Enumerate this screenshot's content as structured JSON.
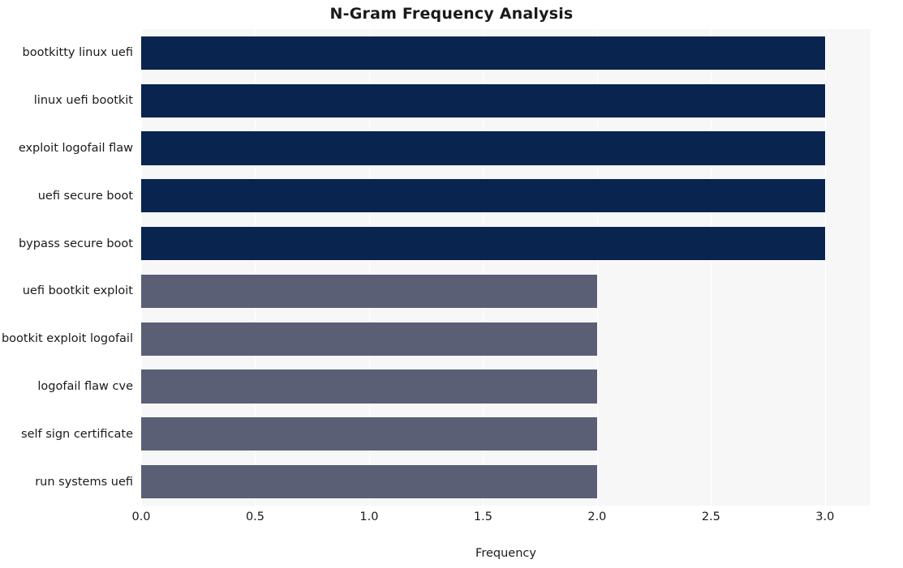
{
  "chart_data": {
    "type": "bar",
    "orientation": "horizontal",
    "title": "N-Gram Frequency Analysis",
    "xlabel": "Frequency",
    "ylabel": "",
    "categories": [
      "bootkitty linux uefi",
      "linux uefi bootkit",
      "exploit logofail flaw",
      "uefi secure boot",
      "bypass secure boot",
      "uefi bootkit exploit",
      "bootkit exploit logofail",
      "logofail flaw cve",
      "self sign certificate",
      "run systems uefi"
    ],
    "values": [
      3,
      3,
      3,
      3,
      3,
      2,
      2,
      2,
      2,
      2
    ],
    "bar_colors": [
      "#08244f",
      "#08244f",
      "#08244f",
      "#08244f",
      "#08244f",
      "#5b5f75",
      "#5b5f75",
      "#5b5f75",
      "#5b5f75",
      "#5b5f75"
    ],
    "xlim": [
      0,
      3.2
    ],
    "xticks": [
      0.0,
      0.5,
      1.0,
      1.5,
      2.0,
      2.5,
      3.0
    ],
    "xticklabels": [
      "0.0",
      "0.5",
      "1.0",
      "1.5",
      "2.0",
      "2.5",
      "3.0"
    ],
    "grid": true,
    "grid_axis": "x",
    "legend": null,
    "plot_background": "#f7f7f8",
    "figure_background": "#ffffff"
  }
}
